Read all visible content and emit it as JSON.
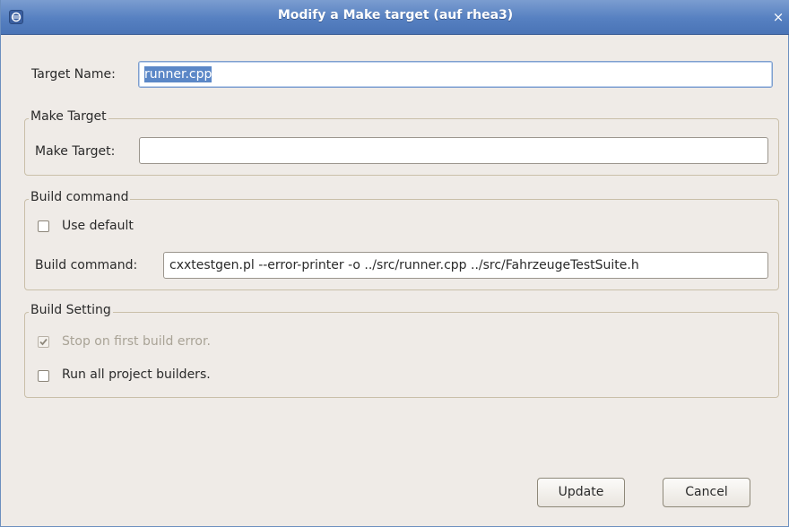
{
  "window": {
    "title": "Modify a Make target  (auf rhea3)",
    "close_glyph": "×",
    "app_icon": "eclipse-icon"
  },
  "target_name": {
    "label": "Target Name:",
    "value": "runner.cpp"
  },
  "make_target_group": {
    "title": "Make Target",
    "label": "Make Target:",
    "value": ""
  },
  "build_command_group": {
    "title": "Build command",
    "use_default": {
      "label": "Use default",
      "checked": false
    },
    "label": "Build command:",
    "value": "cxxtestgen.pl --error-printer -o ../src/runner.cpp ../src/FahrzeugeTestSuite.h"
  },
  "build_setting_group": {
    "title": "Build Setting",
    "stop_on_error": {
      "label": "Stop on first build error.",
      "checked": true,
      "enabled": false
    },
    "run_all_builders": {
      "label": "Run all project builders.",
      "checked": false,
      "enabled": true
    }
  },
  "buttons": {
    "update": "Update",
    "cancel": "Cancel"
  },
  "colors": {
    "titlebar": "#5680c1",
    "dialog_bg": "#efebe7",
    "selection": "#5b87c7"
  }
}
